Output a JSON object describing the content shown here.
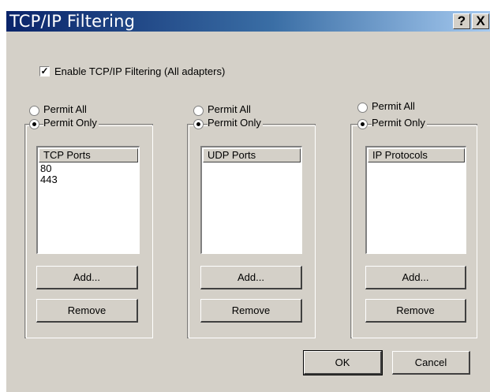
{
  "window": {
    "title": "TCP/IP Filtering",
    "help_label": "?",
    "close_label": "X"
  },
  "enable_filtering": {
    "label": "Enable TCP/IP Filtering (All adapters)",
    "checked": true
  },
  "panels": [
    {
      "permit_all_label": "Permit All",
      "permit_only_label": "Permit Only",
      "selected": "permit_only",
      "list_header": "TCP Ports",
      "items": [
        "80",
        "443"
      ],
      "add_label": "Add...",
      "remove_label": "Remove"
    },
    {
      "permit_all_label": "Permit All",
      "permit_only_label": "Permit Only",
      "selected": "permit_only",
      "list_header": "UDP Ports",
      "items": [],
      "add_label": "Add...",
      "remove_label": "Remove"
    },
    {
      "permit_all_label": "Permit All",
      "permit_only_label": "Permit Only",
      "selected": "permit_only",
      "list_header": "IP Protocols",
      "items": [],
      "add_label": "Add...",
      "remove_label": "Remove"
    }
  ],
  "footer": {
    "ok_label": "OK",
    "cancel_label": "Cancel"
  }
}
